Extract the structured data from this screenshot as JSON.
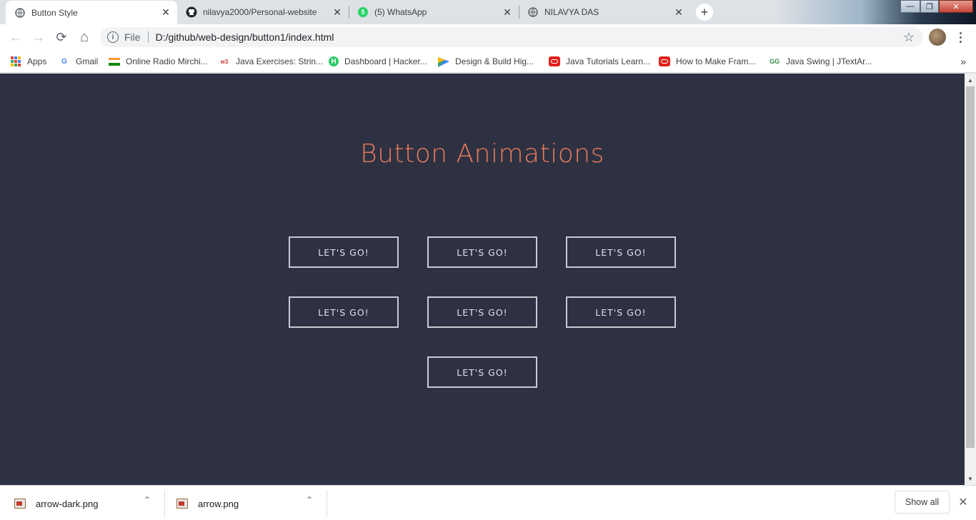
{
  "tabs": [
    {
      "title": "Button Style",
      "icon": "globe-icon",
      "active": true
    },
    {
      "title": "nilavya2000/Personal-website",
      "icon": "github-icon",
      "active": false
    },
    {
      "title": "(5) WhatsApp",
      "icon": "whatsapp-icon",
      "active": false,
      "badge": "5"
    },
    {
      "title": "NILAVYA DAS",
      "icon": "globe-icon",
      "active": false
    }
  ],
  "tab_close_glyph": "✕",
  "new_tab_glyph": "+",
  "window_controls": {
    "minimize": "—",
    "maximize": "❐",
    "close": "✕"
  },
  "toolbar": {
    "back_icon": "←",
    "forward_icon": "→",
    "reload_icon": "⟳",
    "home_icon": "⌂",
    "info_glyph": "i",
    "scheme_label": "File",
    "url": "D:/github/web-design/button1/index.html",
    "star_icon": "☆"
  },
  "bookmarks": [
    {
      "label": "Apps",
      "icon": "apps-grid-icon"
    },
    {
      "label": "Gmail",
      "icon": "google-icon",
      "glyph": "G"
    },
    {
      "label": "Online Radio Mirchi...",
      "icon": "india-flag-icon"
    },
    {
      "label": "Java Exercises: Strin...",
      "icon": "w3resource-icon",
      "glyph": "w3"
    },
    {
      "label": "Dashboard | Hacker...",
      "icon": "hackerrank-icon",
      "glyph": "H"
    },
    {
      "label": "Design & Build Hig...",
      "icon": "design-icon"
    },
    {
      "label": "Java Tutorials Learn...",
      "icon": "oracle-icon"
    },
    {
      "label": "How to Make Fram...",
      "icon": "oracle-icon"
    },
    {
      "label": "Java Swing | JTextAr...",
      "icon": "geeksforgeeks-icon",
      "glyph": "GG"
    }
  ],
  "bookmarks_overflow": "»",
  "page": {
    "title": "Button Animations",
    "buttons": [
      "LET'S GO!",
      "LET'S GO!",
      "LET'S GO!",
      "LET'S GO!",
      "LET'S GO!",
      "LET'S GO!",
      "LET'S GO!"
    ]
  },
  "colors": {
    "page_background": "#2e3142",
    "title_color": "#e97b5a",
    "button_border": "#c8cad2"
  },
  "downloads": [
    {
      "filename": "arrow-dark.png"
    },
    {
      "filename": "arrow.png"
    }
  ],
  "download_caret": "⌃",
  "shelf": {
    "show_all": "Show all",
    "close_glyph": "✕"
  },
  "scrollbar": {
    "up": "▲",
    "down": "▼"
  }
}
